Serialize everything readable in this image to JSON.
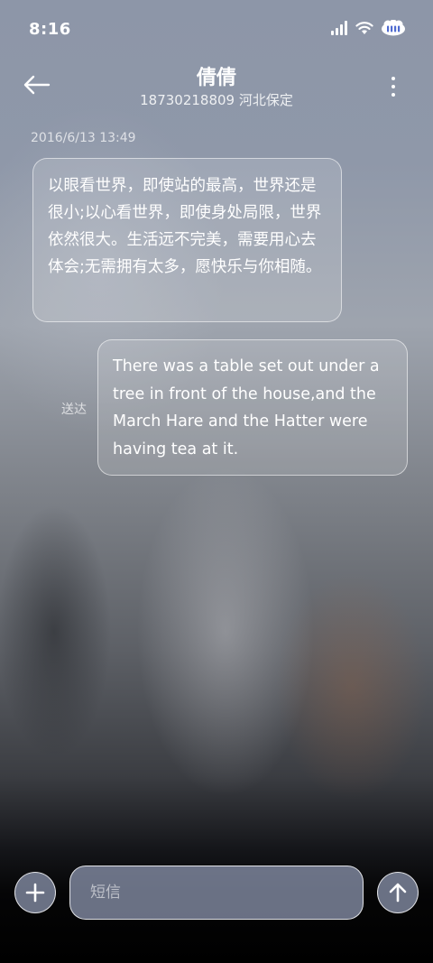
{
  "status_bar": {
    "time": "8:16",
    "icons": [
      "signal-icon",
      "wifi-icon",
      "battery-icon"
    ]
  },
  "header": {
    "title": "倩倩",
    "subtitle": "18730218809 河北保定"
  },
  "conversation": {
    "timestamp": "2016/6/13 13:49",
    "messages": [
      {
        "direction": "incoming",
        "text": "以眼看世界，即使站的最高，世界还是很小;以心看世界，即使身处局限，世界依然很大。生活远不完美，需要用心去体会;无需拥有太多，愿快乐与你相随。"
      },
      {
        "direction": "outgoing",
        "text": "There was a table set out under a tree in front of the house,and the March Hare and the Hatter were having tea at it.",
        "status": "送达"
      }
    ]
  },
  "composer": {
    "placeholder": "短信",
    "value": ""
  },
  "colors": {
    "bubble_border": "#ffffff",
    "button_fill": "#8c96af",
    "background_top": "#8d96a8",
    "background_bottom": "#000000"
  }
}
